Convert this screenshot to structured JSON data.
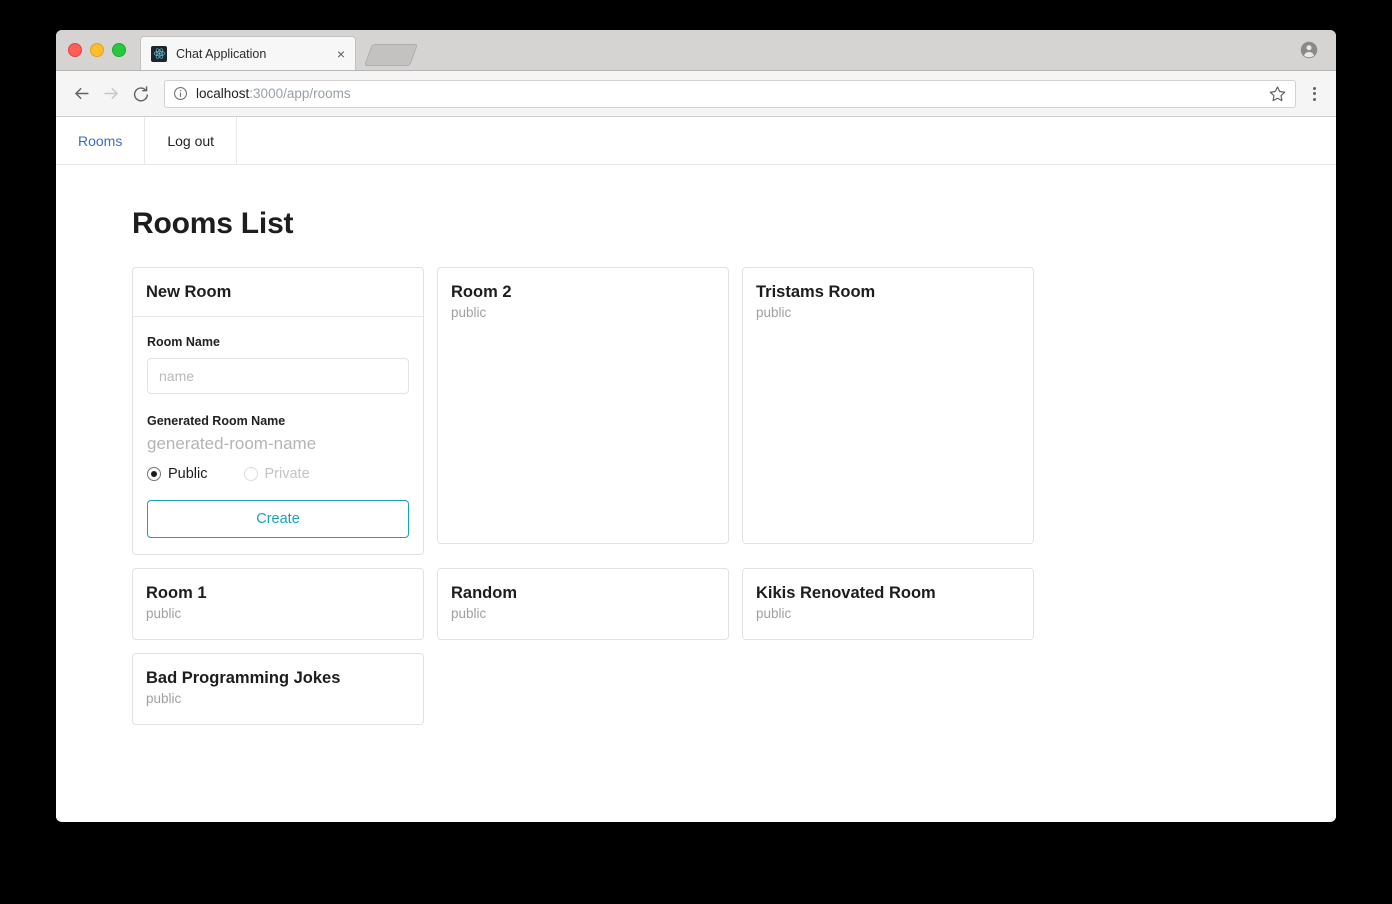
{
  "browser": {
    "tab": {
      "title": "Chat Application",
      "favicon": "react-logo-icon",
      "close_label": "×"
    },
    "omnibox": {
      "host": "localhost",
      "path": ":3000/app/rooms",
      "security_icon": "info-circle-icon"
    },
    "controls": {
      "back": "back-arrow-icon",
      "forward": "forward-arrow-icon",
      "reload": "reload-icon",
      "bookmark": "star-icon",
      "menu": "three-dot-menu-icon",
      "profile": "profile-avatar-icon",
      "new_tab": "new-tab-button"
    }
  },
  "app_nav": {
    "items": [
      {
        "label": "Rooms",
        "active": true
      },
      {
        "label": "Log out",
        "active": false
      }
    ]
  },
  "page": {
    "title": "Rooms List"
  },
  "new_room_card": {
    "header": "New Room",
    "room_name_label": "Room Name",
    "room_name_value": "",
    "room_name_placeholder": "name",
    "generated_label": "Generated Room Name",
    "generated_value": "generated-room-name",
    "visibility": {
      "public_label": "Public",
      "private_label": "Private",
      "selected": "Public",
      "private_disabled": true
    },
    "create_label": "Create"
  },
  "rooms": [
    {
      "name": "Room 2",
      "visibility": "public",
      "size": "tall"
    },
    {
      "name": "Tristams Room",
      "visibility": "public",
      "size": "tall"
    },
    {
      "name": "Room 1",
      "visibility": "public",
      "size": "short"
    },
    {
      "name": "Random",
      "visibility": "public",
      "size": "short"
    },
    {
      "name": "Kikis Renovated Room",
      "visibility": "public",
      "size": "short"
    },
    {
      "name": "Bad Programming Jokes",
      "visibility": "public",
      "size": "short"
    }
  ],
  "colors": {
    "accent_teal": "#17a2b8",
    "link_blue": "#3b6ecc",
    "muted_grey": "#a0a0a0"
  }
}
